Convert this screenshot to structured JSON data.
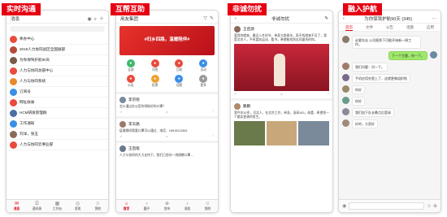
{
  "panels": {
    "chat": {
      "tag": "实时沟通",
      "title": "消息",
      "rows": [
        {
          "name": "休办中心",
          "sub": "",
          "color": "#e84b3c"
        },
        {
          "name": "2019人力协同战区全国展部",
          "sub": "",
          "color": "#b44a3a"
        },
        {
          "name": "为你保驾护航90天",
          "sub": "",
          "color": "#7a5b4a"
        },
        {
          "name": "人力与协同总部中心",
          "sub": "",
          "color": "#e84b3c"
        },
        {
          "name": "人力与协同系统",
          "sub": "",
          "color": "#e98a2a"
        },
        {
          "name": "订阅号",
          "sub": "",
          "color": "#3a8ee6"
        },
        {
          "name": "网址收录",
          "sub": "",
          "color": "#e84b3c"
        },
        {
          "name": "HCM研发管理群",
          "sub": "",
          "color": "#4a6fa5"
        },
        {
          "name": "工作通知",
          "sub": "",
          "color": "#3a8ee6"
        },
        {
          "name": "刘洋，张玉",
          "sub": "",
          "color": "#8a6a5a"
        },
        {
          "name": "人力与协同云事业部",
          "sub": "",
          "color": "#e84b3c"
        }
      ],
      "nav": [
        "消息",
        "通讯录",
        "工作台",
        "发现",
        "我的"
      ]
    },
    "community": {
      "tag": "互帮互助",
      "title": "用友集团",
      "banner": "#归乡四路，温暖陪伴#",
      "grid": [
        {
          "label": "全部",
          "color": "#3eb86b"
        },
        {
          "label": "问答",
          "color": "#e84b3c"
        },
        {
          "label": "互助",
          "color": "#e84b3c"
        },
        {
          "label": "活动",
          "color": "#3a8ee6"
        },
        {
          "label": "公告",
          "color": "#e84b3c"
        },
        {
          "label": "投票",
          "color": "#f0a030"
        },
        {
          "label": "话题",
          "color": "#3a8ee6"
        },
        {
          "label": "更多",
          "color": "#9a9a9a"
        }
      ],
      "posts": [
        {
          "author": "李京晓",
          "text": "怎么通过办公室的领取好的口罩？"
        },
        {
          "author": "李天路",
          "text": "疫情期间需要口罩可以通过、电话：18518112861"
        },
        {
          "author": "王启能",
          "text": "人力与协同的大力支持下，我们已经向一线捐赠口罩…"
        }
      ],
      "nav": [
        "首页",
        "圈子",
        "发布",
        "消息",
        "我的"
      ]
    },
    "help": {
      "tag": "非诚勿扰",
      "title": "非诚勿扰",
      "posts": [
        {
          "author": "王启源",
          "text": "爱我你就来，最近入冬时节，单身大龄青年，再不找就来不及了，我是北京人，平时喜欢运动、看书，希望能找到志同道合的你。"
        },
        {
          "author": "鹏鹏",
          "text": "我今年30岁，河北人，在北京工作，单身，身高163，体重…希望找一个踏实靠谱的男生。"
        }
      ]
    },
    "onboard": {
      "tag": "融入护航",
      "title": "为你保驾护航90天 (345)",
      "tabs": [
        "首页",
        "文件",
        "公告",
        "话题",
        "应用"
      ],
      "messages": [
        {
          "side": "l",
          "text": "必要先去 公司报到下可能开始新一周工作。"
        },
        {
          "side": "r",
          "text": "下一个主题，你一下。"
        },
        {
          "side": "l",
          "text": "我们问题：问一下。"
        },
        {
          "side": "l",
          "text": "手机应用先登上了，这就更像组织啦"
        },
        {
          "side": "l",
          "text": "你好"
        },
        {
          "side": "l",
          "text": "你好"
        },
        {
          "side": "l",
          "text": "我们加下队长晚点后登录"
        },
        {
          "side": "l",
          "text": "好的，大家好"
        }
      ]
    }
  }
}
